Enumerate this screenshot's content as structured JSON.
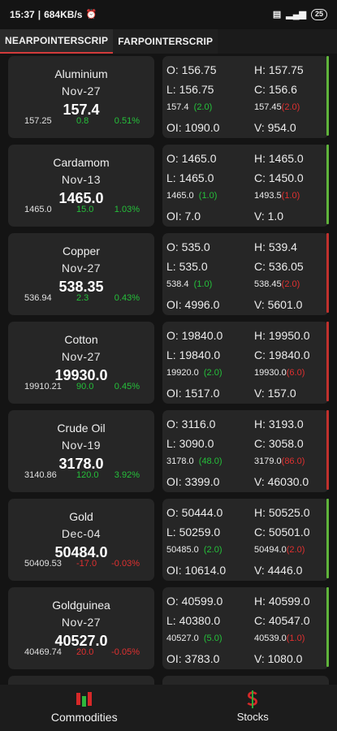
{
  "status_bar": {
    "time": "15:37",
    "speed": "684KB/s",
    "battery": "25"
  },
  "tabs": [
    {
      "label": "NEARPOINTERSCRIP",
      "active": true
    },
    {
      "label": "FARPOINTERSCRIP",
      "active": false
    }
  ],
  "items": [
    {
      "name": "Aluminium",
      "date": "Nov-27",
      "price": "157.4",
      "prev": "157.25",
      "change": "0.8",
      "pct": "0.51%",
      "dir": "pos",
      "open": "O: 156.75",
      "high": "H: 157.75",
      "low": "L: 156.75",
      "close": "C: 156.6",
      "bid": "157.4",
      "bid_qty": "(2.0)",
      "ask": "157.45",
      "ask_qty": "(2.0)",
      "oi": "OI: 1090.0",
      "vol": "V: 954.0",
      "bar": "green"
    },
    {
      "name": "Cardamom",
      "date": "Nov-13",
      "price": "1465.0",
      "prev": "1465.0",
      "change": "15.0",
      "pct": "1.03%",
      "dir": "pos",
      "open": "O: 1465.0",
      "high": "H: 1465.0",
      "low": "L: 1465.0",
      "close": "C: 1450.0",
      "bid": "1465.0",
      "bid_qty": "(1.0)",
      "ask": "1493.5",
      "ask_qty": "(1.0)",
      "oi": "OI: 7.0",
      "vol": "V: 1.0",
      "bar": "green"
    },
    {
      "name": "Copper",
      "date": "Nov-27",
      "price": "538.35",
      "prev": "536.94",
      "change": "2.3",
      "pct": "0.43%",
      "dir": "pos",
      "open": "O: 535.0",
      "high": "H: 539.4",
      "low": "L: 535.0",
      "close": "C: 536.05",
      "bid": "538.4",
      "bid_qty": "(1.0)",
      "ask": "538.45",
      "ask_qty": "(2.0)",
      "oi": "OI: 4996.0",
      "vol": "V: 5601.0",
      "bar": "red"
    },
    {
      "name": "Cotton",
      "date": "Nov-27",
      "price": "19930.0",
      "prev": "19910.21",
      "change": "90.0",
      "pct": "0.45%",
      "dir": "pos",
      "open": "O: 19840.0",
      "high": "H: 19950.0",
      "low": "L: 19840.0",
      "close": "C: 19840.0",
      "bid": "19920.0",
      "bid_qty": "(2.0)",
      "ask": "19930.0",
      "ask_qty": "(6.0)",
      "oi": "OI: 1517.0",
      "vol": "V: 157.0",
      "bar": "red"
    },
    {
      "name": "Crude Oil",
      "date": "Nov-19",
      "price": "3178.0",
      "prev": "3140.86",
      "change": "120.0",
      "pct": "3.92%",
      "dir": "pos",
      "open": "O: 3116.0",
      "high": "H: 3193.0",
      "low": "L: 3090.0",
      "close": "C: 3058.0",
      "bid": "3178.0",
      "bid_qty": "(48.0)",
      "ask": "3179.0",
      "ask_qty": "(86.0)",
      "oi": "OI: 3399.0",
      "vol": "V: 46030.0",
      "bar": "red"
    },
    {
      "name": "Gold",
      "date": "Dec-04",
      "price": "50484.0",
      "prev": "50409.53",
      "change": "-17.0",
      "pct": "-0.03%",
      "dir": "neg",
      "open": "O: 50444.0",
      "high": "H: 50525.0",
      "low": "L: 50259.0",
      "close": "C: 50501.0",
      "bid": "50485.0",
      "bid_qty": "(2.0)",
      "ask": "50494.0",
      "ask_qty": "(2.0)",
      "oi": "OI: 10614.0",
      "vol": "V: 4446.0",
      "bar": "green"
    },
    {
      "name": "Goldguinea",
      "date": "Nov-27",
      "price": "40527.0",
      "prev": "40469.74",
      "change": "20.0",
      "pct": "-0.05%",
      "dir": "neg",
      "open": "O: 40599.0",
      "high": "H: 40599.0",
      "low": "L: 40380.0",
      "close": "C: 40547.0",
      "bid": "40527.0",
      "bid_qty": "(5.0)",
      "ask": "40539.0",
      "ask_qty": "(1.0)",
      "oi": "OI: 3783.0",
      "vol": "V: 1080.0",
      "bar": "green"
    }
  ],
  "bottom_nav": {
    "commodities": "Commodities",
    "stocks": "Stocks"
  },
  "colors": {
    "positive": "#25c03a",
    "negative": "#e03030",
    "bar_green": "#5fb33b",
    "bar_red": "#c0302d",
    "tab_underline": "#d23b3b"
  },
  "icons": {
    "commodities": "red-green-bars-icon",
    "stocks": "dollar-sign-icon"
  }
}
